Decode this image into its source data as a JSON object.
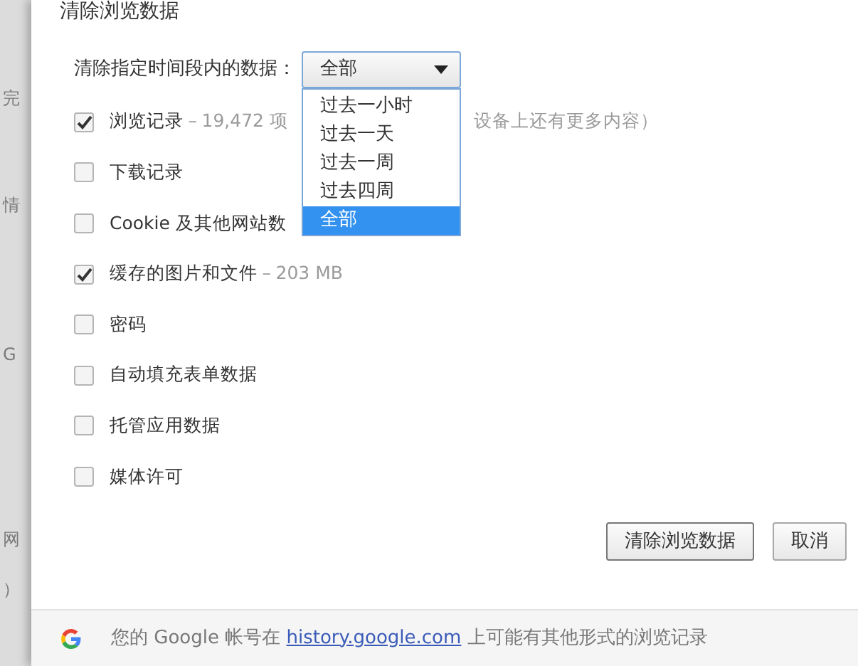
{
  "background_fragments": [
    "完",
    "情",
    "G",
    "网",
    "）"
  ],
  "dialog": {
    "title": "清除浏览数据",
    "range": {
      "label": "清除指定时间段内的数据：",
      "value": "全部",
      "expanded": true,
      "options": [
        {
          "label": "过去一小时",
          "selected": false
        },
        {
          "label": "过去一天",
          "selected": false
        },
        {
          "label": "过去一周",
          "selected": false
        },
        {
          "label": "过去四周",
          "selected": false
        },
        {
          "label": "全部",
          "selected": true
        }
      ]
    },
    "items": [
      {
        "label": "浏览记录",
        "checked": true,
        "separator": "–",
        "detail": "19,472 项",
        "after_menu": "设备上还有更多内容）"
      },
      {
        "label": "下载记录",
        "checked": false
      },
      {
        "label": "Cookie 及其他网站数",
        "checked": false
      },
      {
        "label": "缓存的图片和文件",
        "checked": true,
        "separator": "–",
        "detail": "203 MB"
      },
      {
        "label": "密码",
        "checked": false
      },
      {
        "label": "自动填充表单数据",
        "checked": false
      },
      {
        "label": "托管应用数据",
        "checked": false
      },
      {
        "label": "媒体许可",
        "checked": false
      }
    ],
    "buttons": [
      {
        "label": "清除浏览数据",
        "kind": "primary"
      },
      {
        "label": "取消",
        "kind": "cancel"
      }
    ],
    "footer": {
      "before": "您的 Google 帐号在",
      "link": "history.google.com",
      "after": "上可能有其他形式的浏览记录"
    }
  }
}
